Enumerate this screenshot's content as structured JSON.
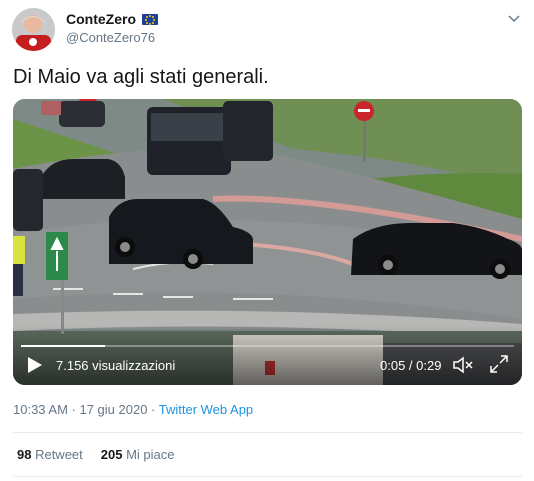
{
  "tweet": {
    "display_name": "ConteZero",
    "handle": "@ConteZero76",
    "badge_icon": "eu-flag-icon",
    "text": "Di Maio va agli stati generali.",
    "timestamp": "10:33 AM · 17 giu 2020 · ",
    "source": "Twitter Web App"
  },
  "video": {
    "views": "7.156 visualizzazioni",
    "time": "0:05 / 0:29",
    "progress": 0.17
  },
  "stats": {
    "retweets_count": "98",
    "retweets_label": " Retweet",
    "likes_count": "205",
    "likes_label": " Mi piace"
  },
  "colors": {
    "link": "#1b95e0",
    "muted": "#657786",
    "text": "#14171a"
  }
}
